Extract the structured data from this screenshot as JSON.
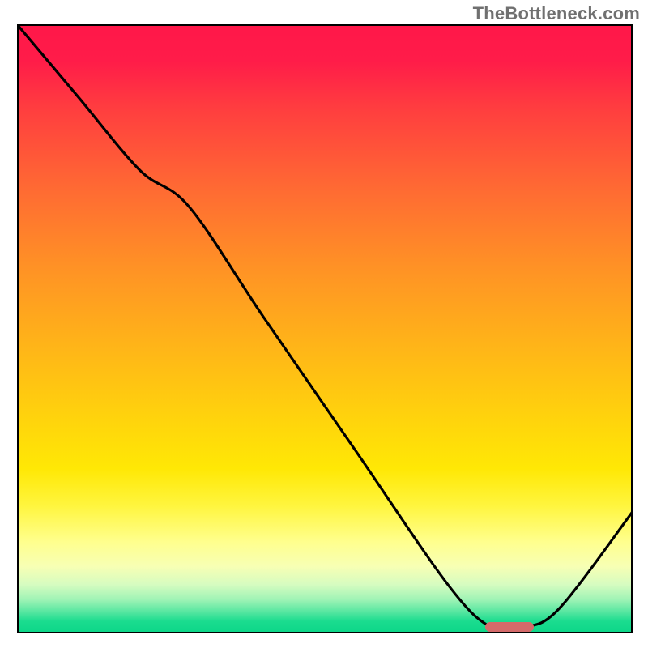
{
  "watermark": "TheBottleneck.com",
  "colors": {
    "curve": "#000000",
    "marker": "#d46a6a",
    "frame": "#000000"
  },
  "chart_data": {
    "type": "line",
    "title": "",
    "xlabel": "",
    "ylabel": "",
    "xlim": [
      0,
      100
    ],
    "ylim": [
      0,
      100
    ],
    "grid": false,
    "series": [
      {
        "name": "bottleneck-curve",
        "x": [
          0,
          10,
          20,
          28,
          40,
          55,
          70,
          77,
          82,
          88,
          100
        ],
        "y": [
          100,
          88,
          76,
          70,
          52,
          30,
          8,
          1,
          1,
          4,
          20
        ]
      }
    ],
    "marker": {
      "name": "optimal-range",
      "x_start": 76,
      "x_end": 84,
      "y": 1
    },
    "background_gradient": {
      "top": "#ff1749",
      "mid": "#ffe805",
      "bottom": "#0bd688"
    }
  }
}
